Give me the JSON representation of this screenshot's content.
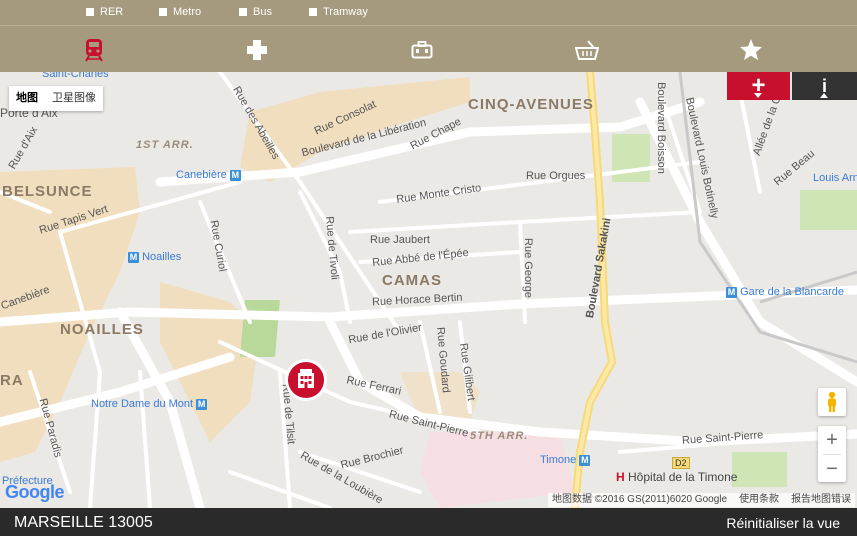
{
  "filters": [
    {
      "label": "RER"
    },
    {
      "label": "Metro"
    },
    {
      "label": "Bus"
    },
    {
      "label": "Tramway"
    }
  ],
  "categories": [
    {
      "icon": "train-icon",
      "active": true
    },
    {
      "icon": "medical-cross-icon"
    },
    {
      "icon": "toolbox-icon"
    },
    {
      "icon": "shopping-basket-icon"
    },
    {
      "icon": "star-icon"
    }
  ],
  "map": {
    "type_control": {
      "map": "地图",
      "satellite": "卫星图像"
    },
    "districts": [
      "CINQ-AVENUES",
      "BELSUNCE",
      "CAMAS",
      "NOAILLES",
      "RA"
    ],
    "arrondissements": [
      "1ST ARR.",
      "5TH ARR."
    ],
    "streets": [
      "Saint-Charles",
      "Porte d'Aix",
      "Rue des Abeilles",
      "Rue Consolat",
      "Boulevard de la Libération",
      "Rue Chape",
      "Boulevard Boisson",
      "Boulevard Louis Botinelly",
      "Allée de la Con",
      "Rue Beau",
      "Rue Monte Cristo",
      "Rue Orgues",
      "Rue Tapis Vert",
      "Rue Curiol",
      "Rue de Tivoli",
      "Rue Jaubert",
      "Rue Abbé de l'Épée",
      "Rue George",
      "Boulevard Sakakini",
      "Rue Horace Bertin",
      "Canebière",
      "Rue de l'Olivier",
      "Rue Goudard",
      "Rue Gilibert",
      "Rue Ferrari",
      "Rue Saint-Pierre",
      "Rue de Tilsit",
      "Rue Brochier",
      "Rue de la Loubière",
      "Rue Paradis",
      "Rue Saint-Pierre",
      "Rue d'Aix",
      "Louis Arn",
      "Préfecture"
    ],
    "pois": {
      "canebiere": "Canebière",
      "noailles": "Noailles",
      "notre_dame": "Notre Dame du Mont",
      "timone": "Timone",
      "blancarde": "Gare de la Blancarde",
      "hopital": "Hôpital de la Timone",
      "d2": "D2",
      "metro_glyph": "M"
    },
    "attribution": {
      "data": "地图数据 ©2016 GS(2011)6020 Google",
      "terms": "使用条款",
      "report": "报告地图错误"
    },
    "google_logo": "Google"
  },
  "controls": {
    "plus": "+",
    "info": "i",
    "zoom_in": "+",
    "zoom_out": "−"
  },
  "footer": {
    "city": "MARSEILLE 13005",
    "reset": "Réinitialiser la vue"
  },
  "colors": {
    "bar": "#a69a7e",
    "accent": "#c8102e",
    "footer": "#2a2a2a",
    "metro": "#3a8fd6"
  }
}
